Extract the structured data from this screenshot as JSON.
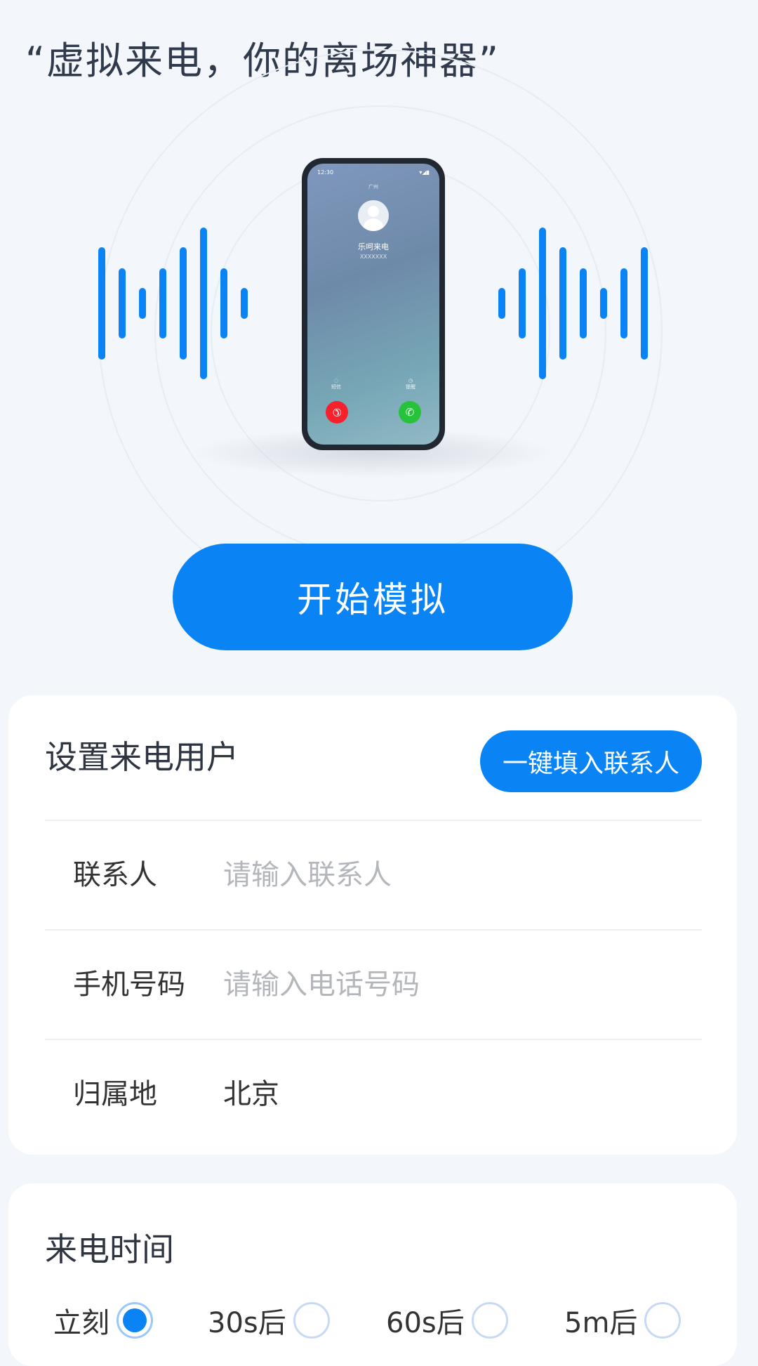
{
  "header": {
    "slogan": "“虚拟来电，你的离场神器”"
  },
  "illustration": {
    "phone": {
      "time": "12:30",
      "city": "广州",
      "caller_name": "乐呵来电",
      "caller_number": "XXXXXXX",
      "message_label": "短信",
      "remind_label": "提醒"
    }
  },
  "actions": {
    "start_label": "开始模拟"
  },
  "caller_card": {
    "title": "设置来电用户",
    "fill_contact_label": "一键填入联系人",
    "fields": {
      "contact": {
        "label": "联系人",
        "placeholder": "请输入联系人",
        "value": ""
      },
      "phone": {
        "label": "手机号码",
        "placeholder": "请输入电话号码",
        "value": ""
      },
      "location": {
        "label": "归属地",
        "value": "北京"
      }
    }
  },
  "time_card": {
    "title": "来电时间",
    "options": [
      {
        "label": "立刻",
        "selected": true
      },
      {
        "label": "30s后",
        "selected": false
      },
      {
        "label": "60s后",
        "selected": false
      },
      {
        "label": "5m后",
        "selected": false
      }
    ]
  },
  "colors": {
    "accent": "#0a84f5",
    "decline": "#f5222d",
    "accept": "#26c33a"
  }
}
